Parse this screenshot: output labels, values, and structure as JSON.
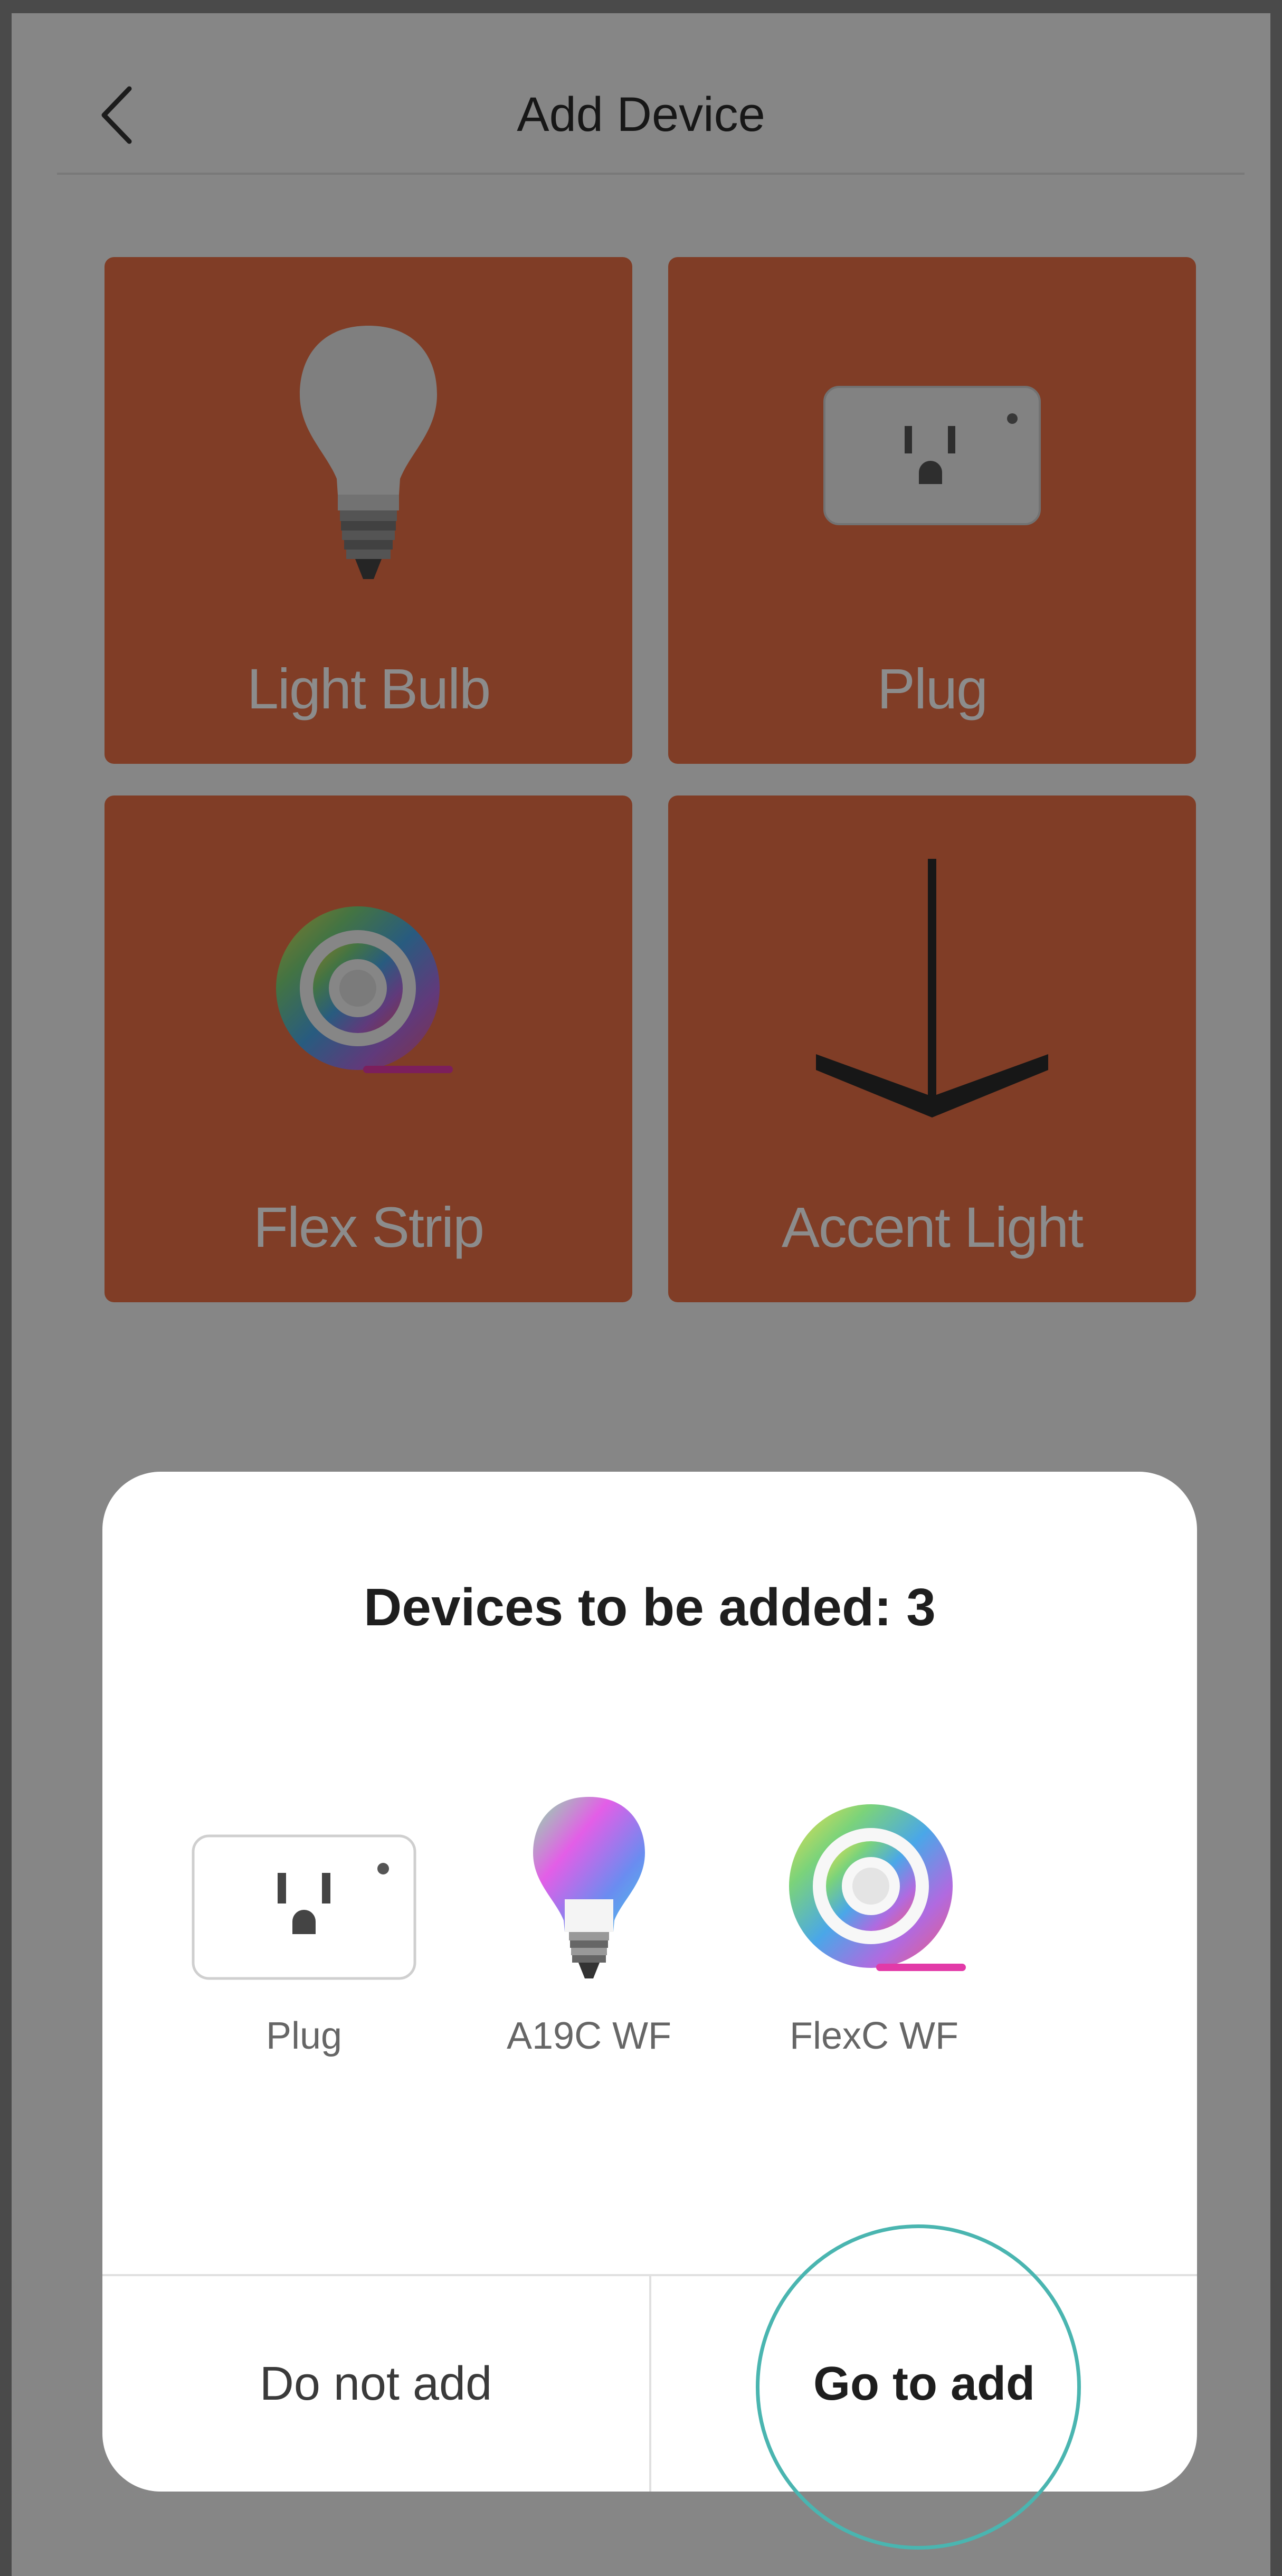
{
  "navbar": {
    "title": "Add Device"
  },
  "categories": [
    {
      "label": "Light Bulb"
    },
    {
      "label": "Plug"
    },
    {
      "label": "Flex Strip"
    },
    {
      "label": "Accent Light"
    }
  ],
  "dialog": {
    "title": "Devices to be added: 3",
    "devices": [
      {
        "label": "Plug",
        "icon": "plug-icon"
      },
      {
        "label": "A19C WF",
        "icon": "color-bulb-icon"
      },
      {
        "label": "FlexC WF",
        "icon": "flex-strip-icon"
      }
    ],
    "cancel_label": "Do not add",
    "confirm_label": "Go to add"
  },
  "colors": {
    "tile": "#ea6f45",
    "highlight": "#4ab5b0",
    "dim_overlay": "rgba(0,0,0,0.45)"
  }
}
